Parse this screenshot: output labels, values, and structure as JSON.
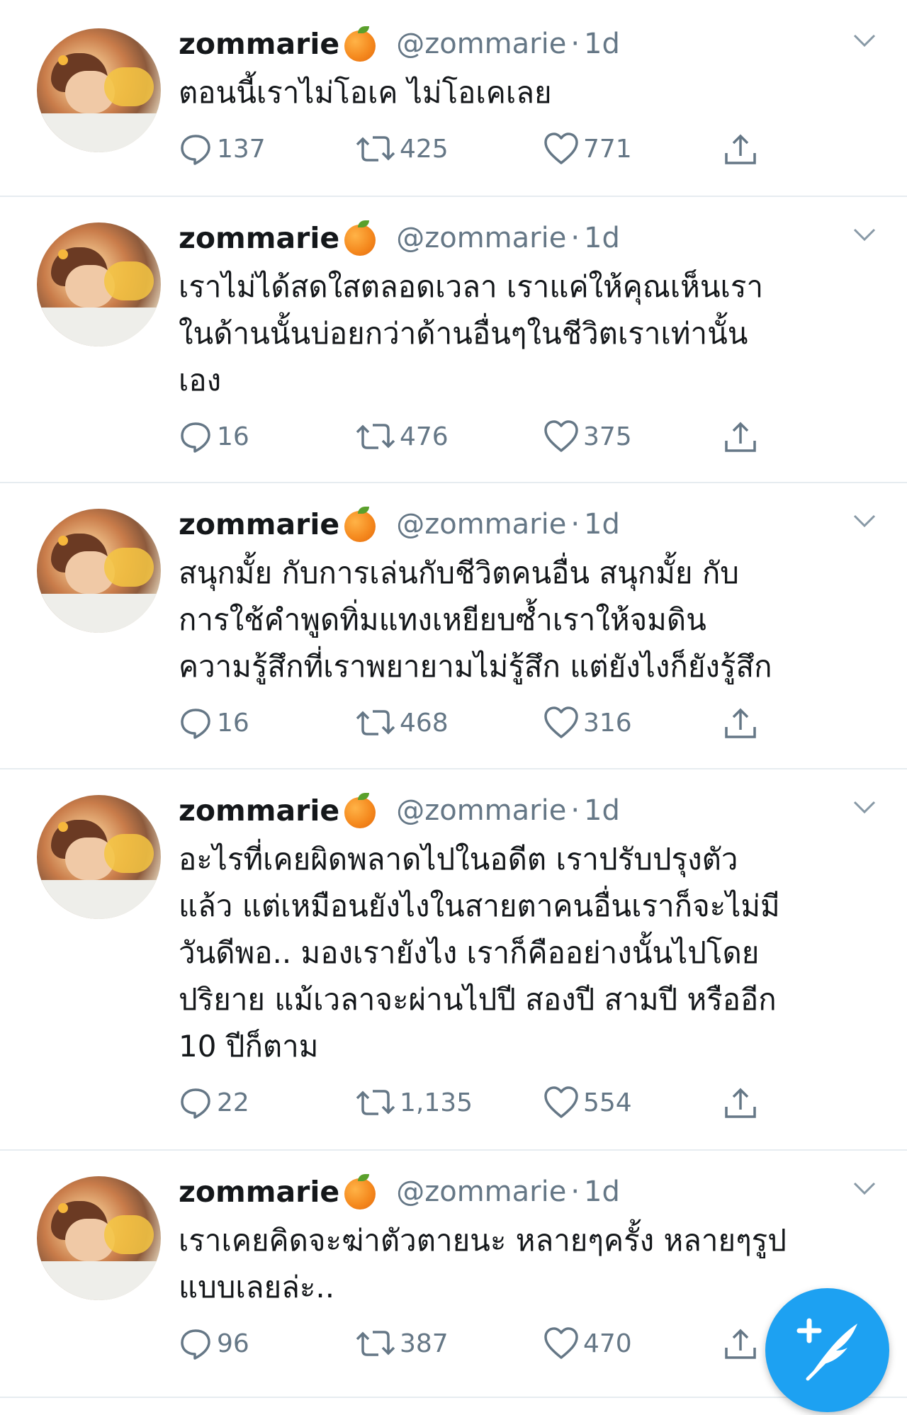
{
  "tweets": [
    {
      "name": "zommarie",
      "handle": "@zommarie",
      "time": "1d",
      "text": "ตอนนี้เราไม่โอเค ไม่โอเคเลย",
      "replies": "137",
      "retweets": "425",
      "likes": "771"
    },
    {
      "name": "zommarie",
      "handle": "@zommarie",
      "time": "1d",
      "text": "เราไม่ได้สดใสตลอดเวลา เราแค่ให้คุณเห็นเรา\nในด้านนั้นบ่อยกว่าด้านอื่นๆในชีวิตเราเท่านั้น\nเอง",
      "replies": "16",
      "retweets": "476",
      "likes": "375"
    },
    {
      "name": "zommarie",
      "handle": "@zommarie",
      "time": "1d",
      "text": "สนุกมั้ย กับการเล่นกับชีวิตคนอื่น สนุกมั้ย กับ\nการใช้คำพูดทิ่มแทงเหยียบซ้ำเราให้จมดิน\nความรู้สึกที่เราพยายามไม่รู้สึก แต่ยังไงก็ยังรู้สึก",
      "replies": "16",
      "retweets": "468",
      "likes": "316"
    },
    {
      "name": "zommarie",
      "handle": "@zommarie",
      "time": "1d",
      "text": "อะไรที่เคยผิดพลาดไปในอดีต เราปรับปรุงตัว\nแล้ว แต่เหมือนยังไงในสายตาคนอื่นเราก็จะไม่มี\nวันดีพอ.. มองเรายังไง เราก็คืออย่างนั้นไปโดย\nปริยาย แม้เวลาจะผ่านไปปี สองปี สามปี หรืออีก\n10 ปีก็ตาม",
      "replies": "22",
      "retweets": "1,135",
      "likes": "554"
    },
    {
      "name": "zommarie",
      "handle": "@zommarie",
      "time": "1d",
      "text": "เราเคยคิดจะฆ่าตัวตายนะ หลายๆครั้ง หลายๆรูป\nแบบเลยล่ะ..",
      "replies": "96",
      "retweets": "387",
      "likes": "470"
    }
  ],
  "separator": "·",
  "colors": {
    "accent": "#1da1f2",
    "muted": "#657786",
    "text": "#14171a",
    "divider": "#e6ecf0"
  }
}
